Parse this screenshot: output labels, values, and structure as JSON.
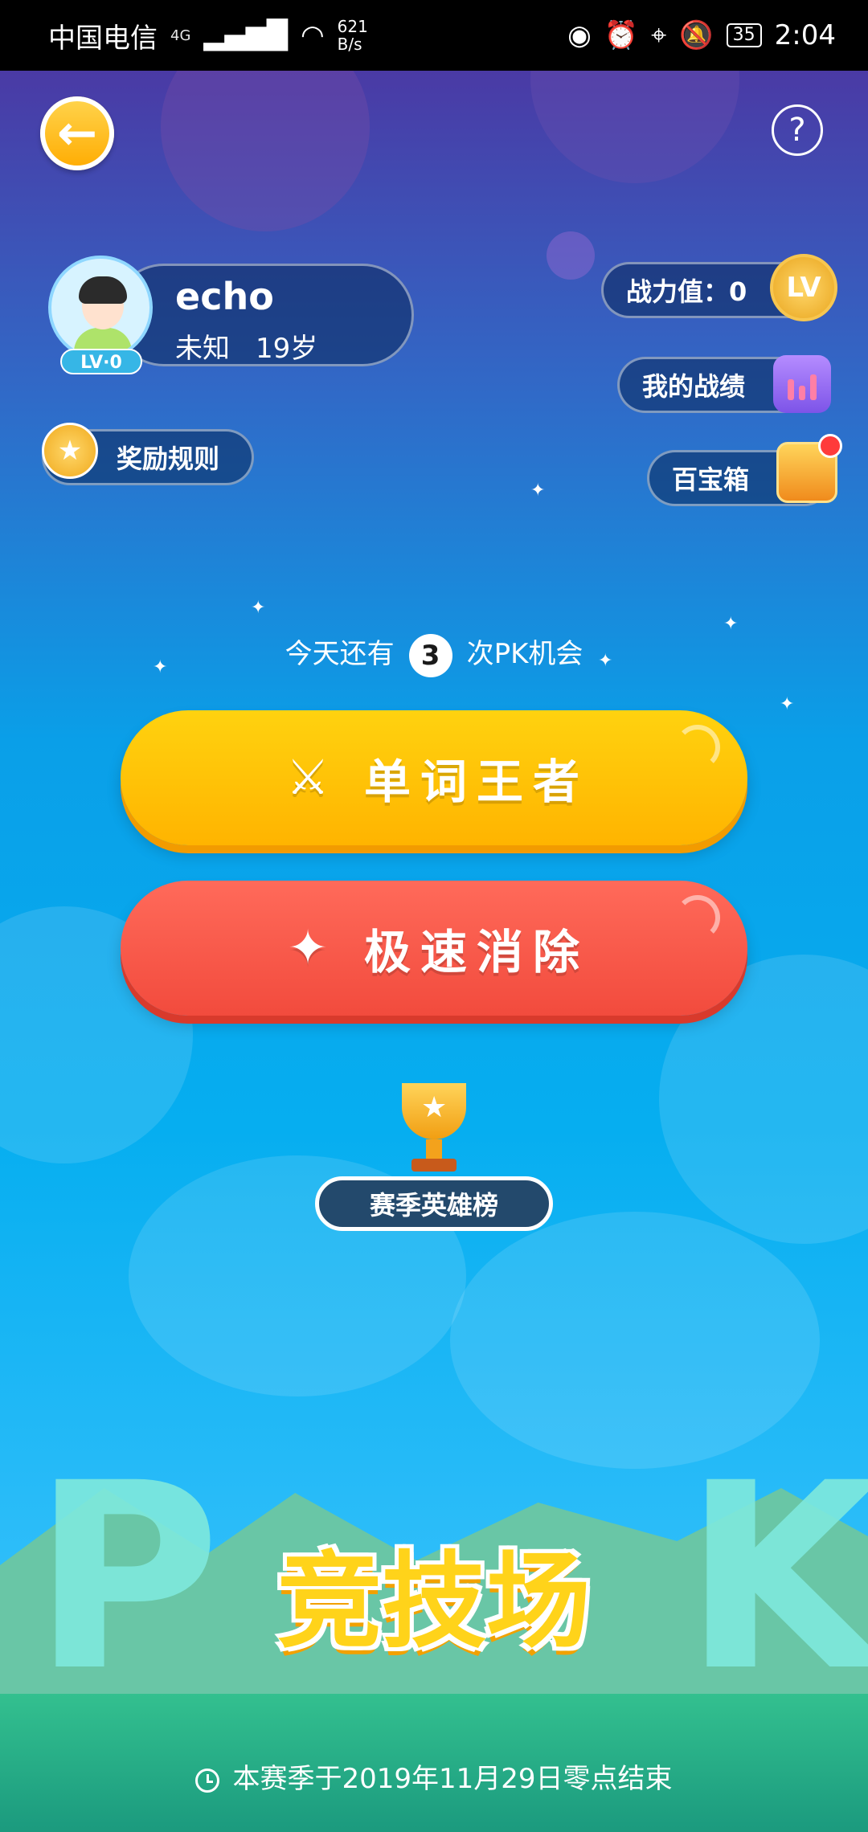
{
  "status_bar": {
    "carrier": "中国电信",
    "network": "4G",
    "net_speed_value": "621",
    "net_speed_unit": "B/s",
    "battery": "35",
    "time": "2:04"
  },
  "profile": {
    "name": "echo",
    "gender": "未知",
    "age": "19岁",
    "level": "LV·0"
  },
  "side_buttons": {
    "power_label": "战力值：0",
    "lv_coin": "LV",
    "record_label": "我的战绩",
    "treasure_label": "百宝箱",
    "reward_rules_label": "奖励规则"
  },
  "chances": {
    "prefix": "今天还有",
    "count": "3",
    "suffix": "次PK机会"
  },
  "modes": {
    "word_king": "单词王者",
    "speed_clear": "极速消除"
  },
  "hero_board": "赛季英雄榜",
  "arena_title": "竞技场",
  "season_end": "本赛季于2019年11月29日零点结束",
  "colors": {
    "yellow_button": "#ffc20a",
    "red_button": "#f4574a",
    "board_button": "#23496c"
  },
  "icons": {
    "back": "arrow-left",
    "help": "question",
    "word_king": "crossed-swords",
    "speed_clear": "magic-wand",
    "trophy": "trophy",
    "clock": "clock"
  }
}
